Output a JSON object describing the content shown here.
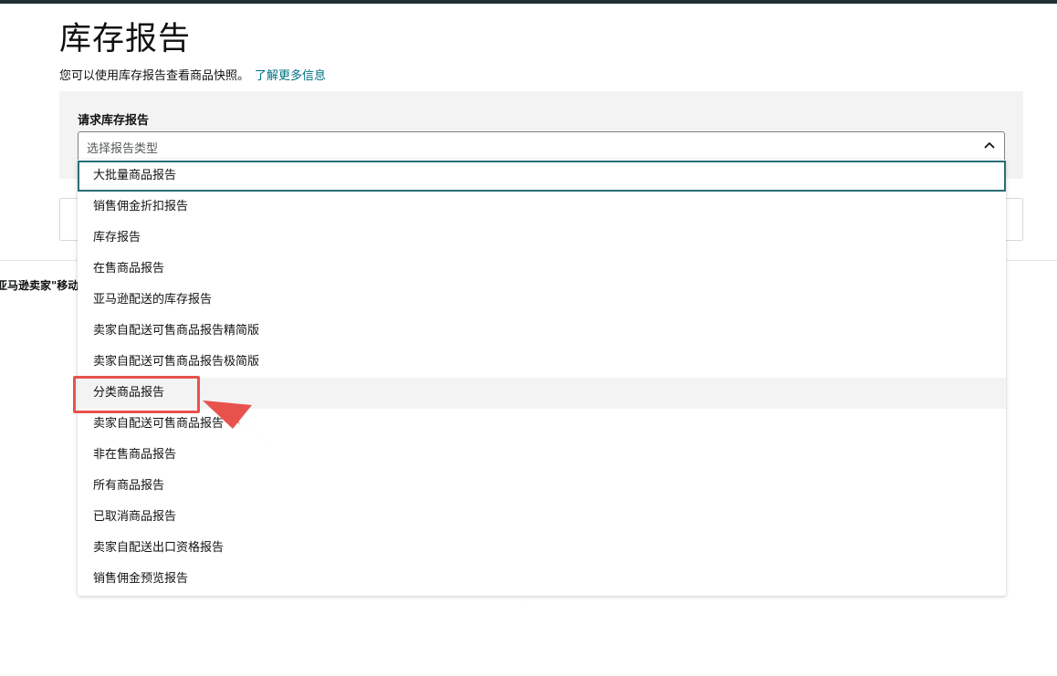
{
  "page": {
    "title": "库存报告",
    "description": "您可以使用库存报告查看商品快照。",
    "learn_more": "了解更多信息"
  },
  "request": {
    "label": "请求库存报告",
    "select_placeholder": "选择报告类型"
  },
  "footer_link": "亚马逊卖家\"移动",
  "options": [
    {
      "label": "大批量商品报告",
      "state": "focused"
    },
    {
      "label": "销售佣金折扣报告",
      "state": "normal"
    },
    {
      "label": "库存报告",
      "state": "normal"
    },
    {
      "label": "在售商品报告",
      "state": "normal"
    },
    {
      "label": "亚马逊配送的库存报告",
      "state": "normal"
    },
    {
      "label": "卖家自配送可售商品报告精简版",
      "state": "normal"
    },
    {
      "label": "卖家自配送可售商品报告极简版",
      "state": "normal"
    },
    {
      "label": "分类商品报告",
      "state": "hovered"
    },
    {
      "label": "卖家自配送可售商品报告",
      "state": "normal"
    },
    {
      "label": "非在售商品报告",
      "state": "normal"
    },
    {
      "label": "所有商品报告",
      "state": "normal"
    },
    {
      "label": "已取消商品报告",
      "state": "normal"
    },
    {
      "label": "卖家自配送出口资格报告",
      "state": "normal"
    },
    {
      "label": "销售佣金预览报告",
      "state": "normal"
    }
  ],
  "colors": {
    "link": "#007185",
    "focus_border": "#2a6e75",
    "annotation": "#e8524c",
    "top_strip": "#1f2f33"
  },
  "icons": {
    "select_toggle": "chevron-up-icon",
    "annotation_arrow": "arrow-icon"
  }
}
